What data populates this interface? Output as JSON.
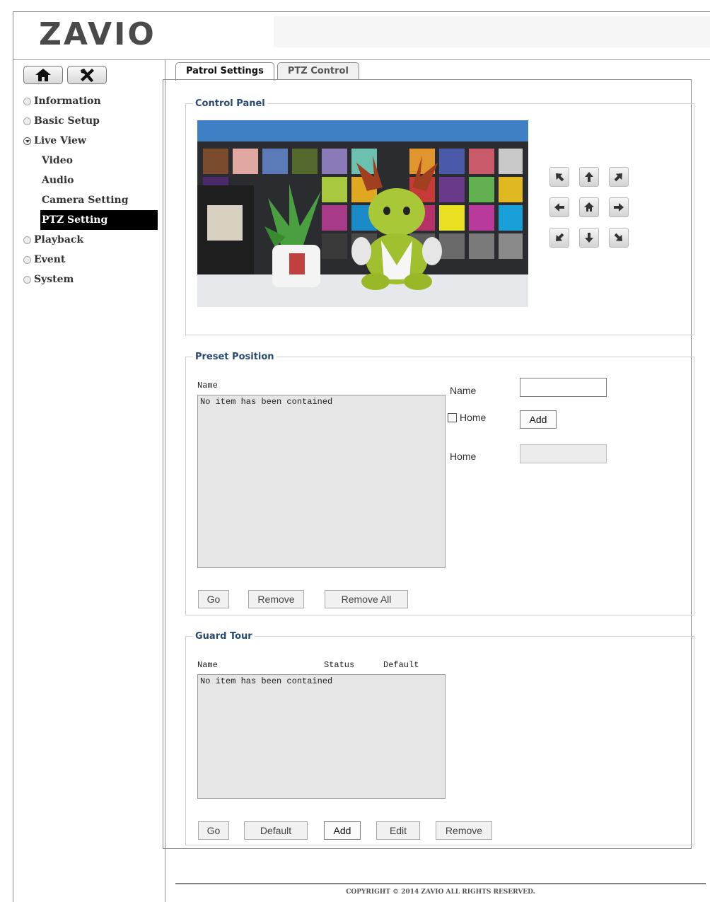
{
  "brand": {
    "logo_text": "ZAVIO"
  },
  "sidebar": {
    "items": [
      {
        "label": "Information"
      },
      {
        "label": "Basic Setup"
      },
      {
        "label": "Live View"
      },
      {
        "label": "Playback"
      },
      {
        "label": "Event"
      },
      {
        "label": "System"
      }
    ],
    "live_view_sub": [
      {
        "label": "Video"
      },
      {
        "label": "Audio"
      },
      {
        "label": "Camera Setting"
      },
      {
        "label": "PTZ Setting"
      }
    ]
  },
  "tabs": [
    {
      "label": "Patrol Settings"
    },
    {
      "label": "PTZ Control"
    }
  ],
  "control_panel": {
    "legend": "Control Panel"
  },
  "preset": {
    "legend": "Preset Position",
    "list_header": "Name",
    "empty_text": "No item has been contained",
    "name_label": "Name",
    "name_value": "",
    "home_checkbox_label": "Home",
    "home_checked": false,
    "add_label": "Add",
    "home_label": "Home",
    "home_value": "",
    "buttons": {
      "go": "Go",
      "remove": "Remove",
      "remove_all": "Remove All"
    }
  },
  "guard": {
    "legend": "Guard Tour",
    "headers": {
      "name": "Name",
      "status": "Status",
      "default": "Default"
    },
    "empty_text": "No item has been contained",
    "buttons": {
      "go": "Go",
      "default": "Default",
      "add": "Add",
      "edit": "Edit",
      "remove": "Remove"
    }
  },
  "footer": {
    "text": "COPYRIGHT © 2014 ZAVIO ALL RIGHTS RESERVED."
  },
  "colors": {
    "legend": "#2a4a76",
    "active_nav_bg": "#000000",
    "list_bg": "#e6e6e6"
  }
}
